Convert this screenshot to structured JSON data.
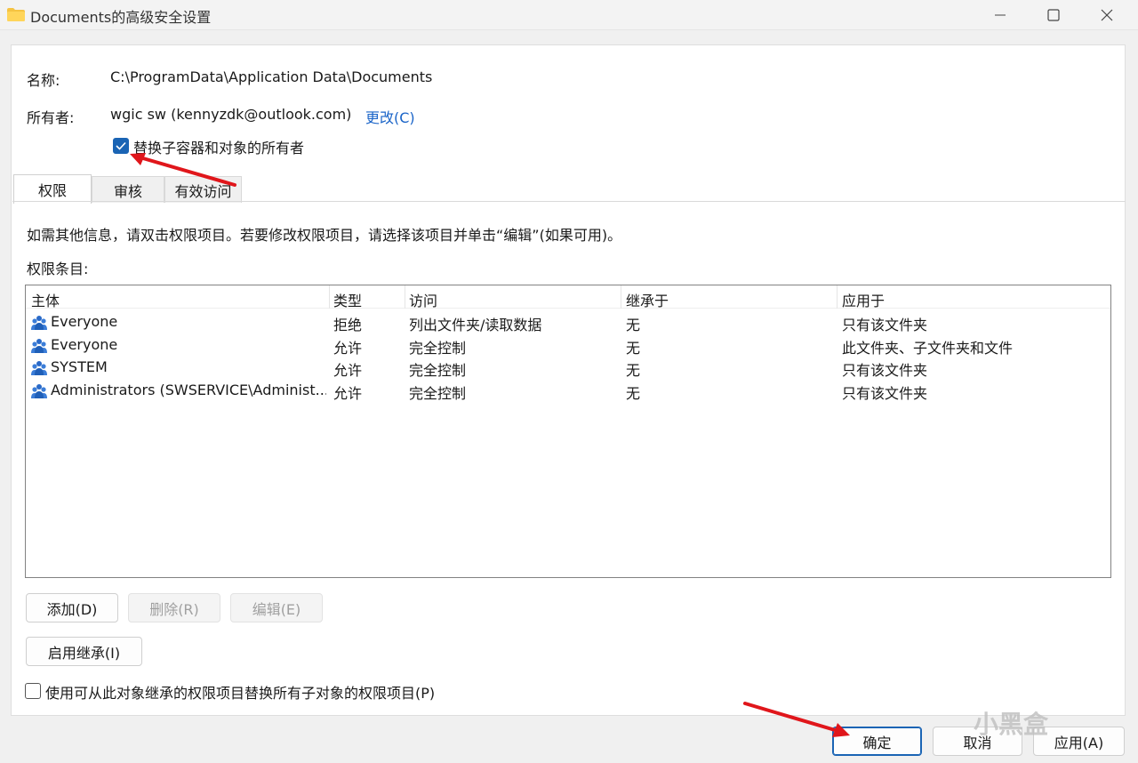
{
  "window": {
    "title": "Documents的高级安全设置"
  },
  "info": {
    "name_label": "名称:",
    "name_value": "C:\\ProgramData\\Application Data\\Documents",
    "owner_label": "所有者:",
    "owner_value": "wgic sw (kennyzdk@outlook.com)",
    "change_link": "更改(C)",
    "replace_owner_label": "替换子容器和对象的所有者",
    "replace_owner_checked": true
  },
  "tabs": [
    {
      "label": "权限",
      "active": true
    },
    {
      "label": "审核",
      "active": false
    },
    {
      "label": "有效访问",
      "active": false
    }
  ],
  "hint_text": "如需其他信息，请双击权限项目。若要修改权限项目，请选择该项目并单击“编辑”(如果可用)。",
  "entries_label": "权限条目:",
  "table": {
    "columns": [
      "主体",
      "类型",
      "访问",
      "继承于",
      "应用于"
    ],
    "rows": [
      {
        "principal": "Everyone",
        "type": "拒绝",
        "access": "列出文件夹/读取数据",
        "inherited": "无",
        "applies": "只有该文件夹"
      },
      {
        "principal": "Everyone",
        "type": "允许",
        "access": "完全控制",
        "inherited": "无",
        "applies": "此文件夹、子文件夹和文件"
      },
      {
        "principal": "SYSTEM",
        "type": "允许",
        "access": "完全控制",
        "inherited": "无",
        "applies": "只有该文件夹"
      },
      {
        "principal": "Administrators (SWSERVICE\\Administ...",
        "type": "允许",
        "access": "完全控制",
        "inherited": "无",
        "applies": "只有该文件夹"
      }
    ]
  },
  "buttons": {
    "add": "添加(D)",
    "remove": "删除(R)",
    "edit": "编辑(E)",
    "enable_inherit": "启用继承(I)",
    "ok": "确定",
    "cancel": "取消",
    "apply": "应用(A)"
  },
  "replace_child_label": "使用可从此对象继承的权限项目替换所有子对象的权限项目(P)",
  "replace_child_checked": false,
  "watermark": "小黑盒",
  "colors": {
    "accent": "#1a64b4",
    "link": "#1a64c8",
    "annotation_arrow": "#e0161b"
  }
}
